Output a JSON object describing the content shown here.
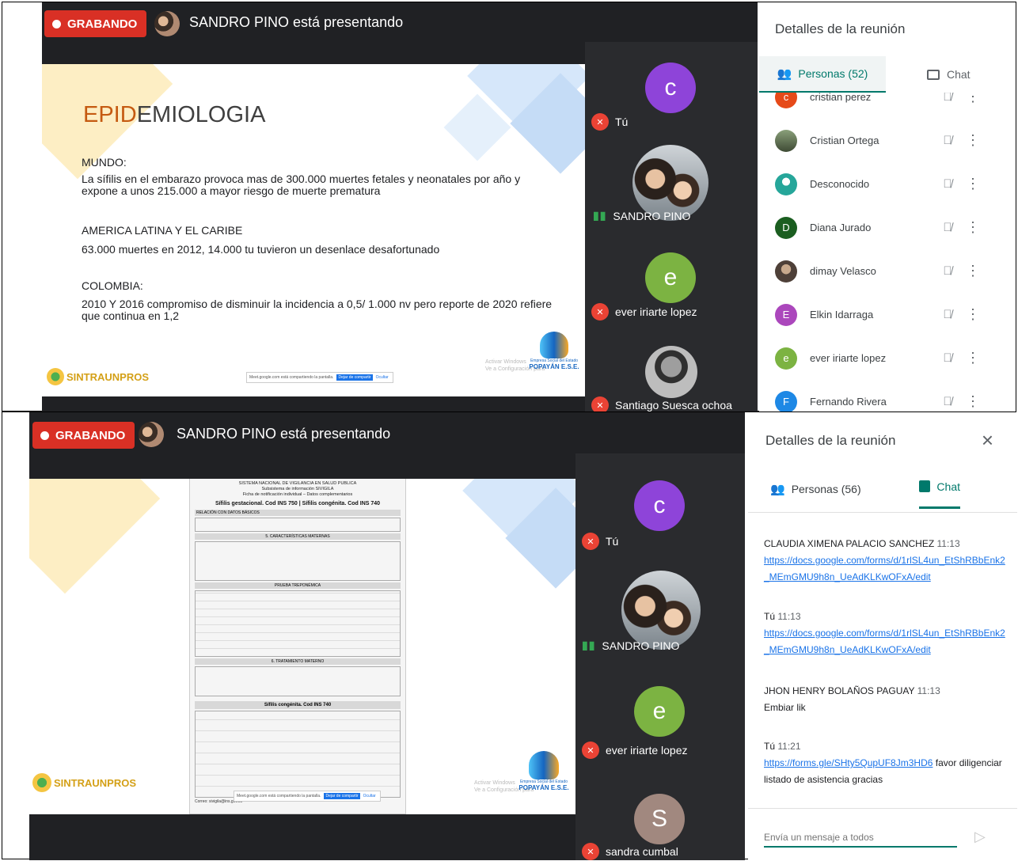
{
  "colors": {
    "recording_red": "#d93025",
    "meet_dark": "#202124",
    "accent_blue": "#1a73e8",
    "accent_teal": "#00796b",
    "tile_purple": "#8e44d9",
    "tile_green": "#7cb342",
    "tile_brown": "#a1887f"
  },
  "screens": [
    {
      "recording_label": "GRABANDO",
      "presenter_text": "SANDRO PINO está presentando",
      "slide": {
        "title_prefix": "EPID",
        "title_rest": "EMIOLOGIA",
        "sections": [
          {
            "heading": "MUNDO:",
            "body": "La sífilis  en el embarazo provoca  mas  de  300.000 muertes  fetales  y neonatales por  año y expone  a unos  215.000 a  mayor  riesgo de muerte prematura"
          },
          {
            "heading": "AMERICA LATINA  Y EL  CARIBE",
            "body": "63.000 muertes  en 2012,  14.000 tu tuvieron un desenlace desafortunado"
          },
          {
            "heading": "COLOMBIA:",
            "body": " 2010 Y 2016  compromiso de  disminuir  la incidencia  a 0,5/ 1.000 nv  pero reporte de  2020 refiere que  continua  en 1,2"
          }
        ],
        "logo_left": "SINTRAUNPROS",
        "logo_right_line1": "Empresa Social del Estado",
        "logo_right_line2": "POPAYÁN E.S.E.",
        "windows_line1": "Activar Windows",
        "windows_line2": "Ve a Configuración para",
        "share_notice": "Meet.google.com está compartiendo la pantalla.",
        "share_stop": "Dejar de compartir",
        "share_hide": "Ocultar"
      },
      "tiles": [
        {
          "initial": "c",
          "name": "Tú",
          "muted": true
        },
        {
          "initial": "",
          "name": "SANDRO PINO",
          "muted": false
        },
        {
          "initial": "e",
          "name": "ever iriarte lopez",
          "muted": true
        },
        {
          "initial": "",
          "name": "Santiago Suesca ochoa",
          "muted": true
        }
      ],
      "panel": {
        "title": "Detalles de la reunión",
        "tab_people": "Personas (52)",
        "tab_chat": "Chat",
        "people": [
          {
            "initial": "c",
            "name": "cristian perez",
            "color": "#e64a19"
          },
          {
            "initial": "",
            "name": "Cristian Ortega",
            "color": "#5d6b4a"
          },
          {
            "initial": "",
            "name": "Desconocido",
            "color": "#26a69a"
          },
          {
            "initial": "D",
            "name": "Diana Jurado",
            "color": "#1b5e20"
          },
          {
            "initial": "",
            "name": "dimay Velasco",
            "color": "#6d6259"
          },
          {
            "initial": "E",
            "name": "Elkin Idarraga",
            "color": "#ab47bc"
          },
          {
            "initial": "e",
            "name": "ever iriarte lopez",
            "color": "#7cb342"
          },
          {
            "initial": "F",
            "name": "Fernando Rivera",
            "color": "#1e88e5"
          }
        ]
      }
    },
    {
      "recording_label": "GRABANDO",
      "presenter_text": "SANDRO PINO está presentando",
      "form": {
        "header_line1": "SISTEMA NACIONAL DE VIGILANCIA EN SALUD PUBLICA",
        "header_line2": "Subsistema de información SIVIGILA",
        "header_line3": "Ficha de notificación individual – Datos complementarios",
        "title": "Sífilis gestacional. Cod INS 750 | Sífilis congénita. Cod INS 740",
        "section1": "RELACIÓN CON DATOS BÁSICOS",
        "section2": "5. CARACTERÍSTICAS MATERNAS",
        "section3": "PRUEBA TREPONÉMICA",
        "section4": "6. TRATAMIENTO MATERNO",
        "congenita_title": "Sífilis congénita. Cod INS 740",
        "footer": "Correo: sivigila@ins.gov.co"
      },
      "logo_left": "SINTRAUNPROS",
      "logo_right_line1": "Empresa Social del Estado",
      "logo_right_line2": "POPAYÁN E.S.E.",
      "windows_line1": "Activar Windows",
      "windows_line2": "Ve a Configuración para",
      "share_notice": "Meet.google.com está compartiendo la pantalla.",
      "share_stop": "Dejar de compartir",
      "share_hide": "Ocultar",
      "tiles": [
        {
          "initial": "c",
          "name": "Tú",
          "muted": true
        },
        {
          "initial": "",
          "name": "SANDRO PINO",
          "muted": false
        },
        {
          "initial": "e",
          "name": "ever iriarte lopez",
          "muted": true
        },
        {
          "initial": "S",
          "name": "sandra cumbal",
          "muted": true
        }
      ],
      "panel": {
        "title": "Detalles de la reunión",
        "tab_people": "Personas (56)",
        "tab_chat": "Chat",
        "messages": [
          {
            "sender": "CLAUDIA XIMENA PALACIO SANCHEZ",
            "time": "11:13",
            "link": "https://docs.google.com/forms/d/1rlSL4un_EtShRBbEnk2_MEmGMU9h8n_UeAdKLKwOFxA/edit",
            "text": ""
          },
          {
            "sender": "Tú",
            "time": "11:13",
            "link": "https://docs.google.com/forms/d/1rlSL4un_EtShRBbEnk2_MEmGMU9h8n_UeAdKLKwOFxA/edit",
            "text": ""
          },
          {
            "sender": "JHON HENRY BOLAÑOS PAGUAY",
            "time": "11:13",
            "link": "",
            "text": "Embiar lik"
          },
          {
            "sender": "Tú",
            "time": "11:21",
            "link": "https://forms.gle/SHty5QupUF8Jm3HD6",
            "text": "favor diligenciar listado de asistencia gracias"
          }
        ],
        "input_placeholder": "Envía un mensaje a todos",
        "close_icon": "×"
      }
    }
  ]
}
